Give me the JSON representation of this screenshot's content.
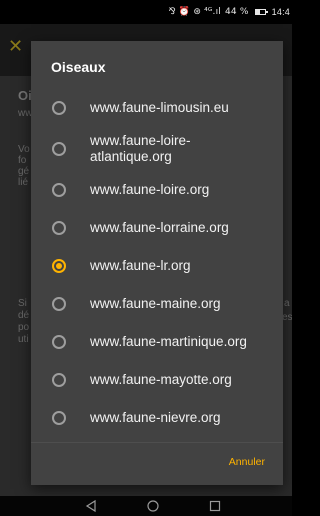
{
  "status_bar": {
    "icons_text": "⅋ ⏰ ⊛ ⁴ᴳ.ıl",
    "battery_percent": "44 %",
    "time": "14:4"
  },
  "background_app": {
    "header_fragment": "Oi",
    "subheader_fragment": "ww",
    "paragraph1_lines": [
      "Vo",
      "fo",
      "gé",
      "lié"
    ],
    "paragraph2_lines": [
      "Si",
      "dé",
      "po",
      "uti"
    ],
    "right_fragments": [
      "a",
      "es"
    ]
  },
  "dialog": {
    "title": "Oiseaux",
    "options": [
      {
        "label": "www.faune-limousin.eu",
        "selected": false
      },
      {
        "label": "www.faune-loire-atlantique.org",
        "selected": false
      },
      {
        "label": "www.faune-loire.org",
        "selected": false
      },
      {
        "label": "www.faune-lorraine.org",
        "selected": false
      },
      {
        "label": "www.faune-lr.org",
        "selected": true
      },
      {
        "label": "www.faune-maine.org",
        "selected": false
      },
      {
        "label": "www.faune-martinique.org",
        "selected": false
      },
      {
        "label": "www.faune-mayotte.org",
        "selected": false
      },
      {
        "label": "www.faune-nievre.org",
        "selected": false
      }
    ],
    "cancel_label": "Annuler"
  },
  "colors": {
    "accent": "#ffb300",
    "dialog_bg": "#424242",
    "text": "#f2f2f2"
  },
  "nav_bar": {
    "back_icon": "triangle-back-icon",
    "home_icon": "circle-home-icon",
    "recent_icon": "square-recent-icon"
  }
}
